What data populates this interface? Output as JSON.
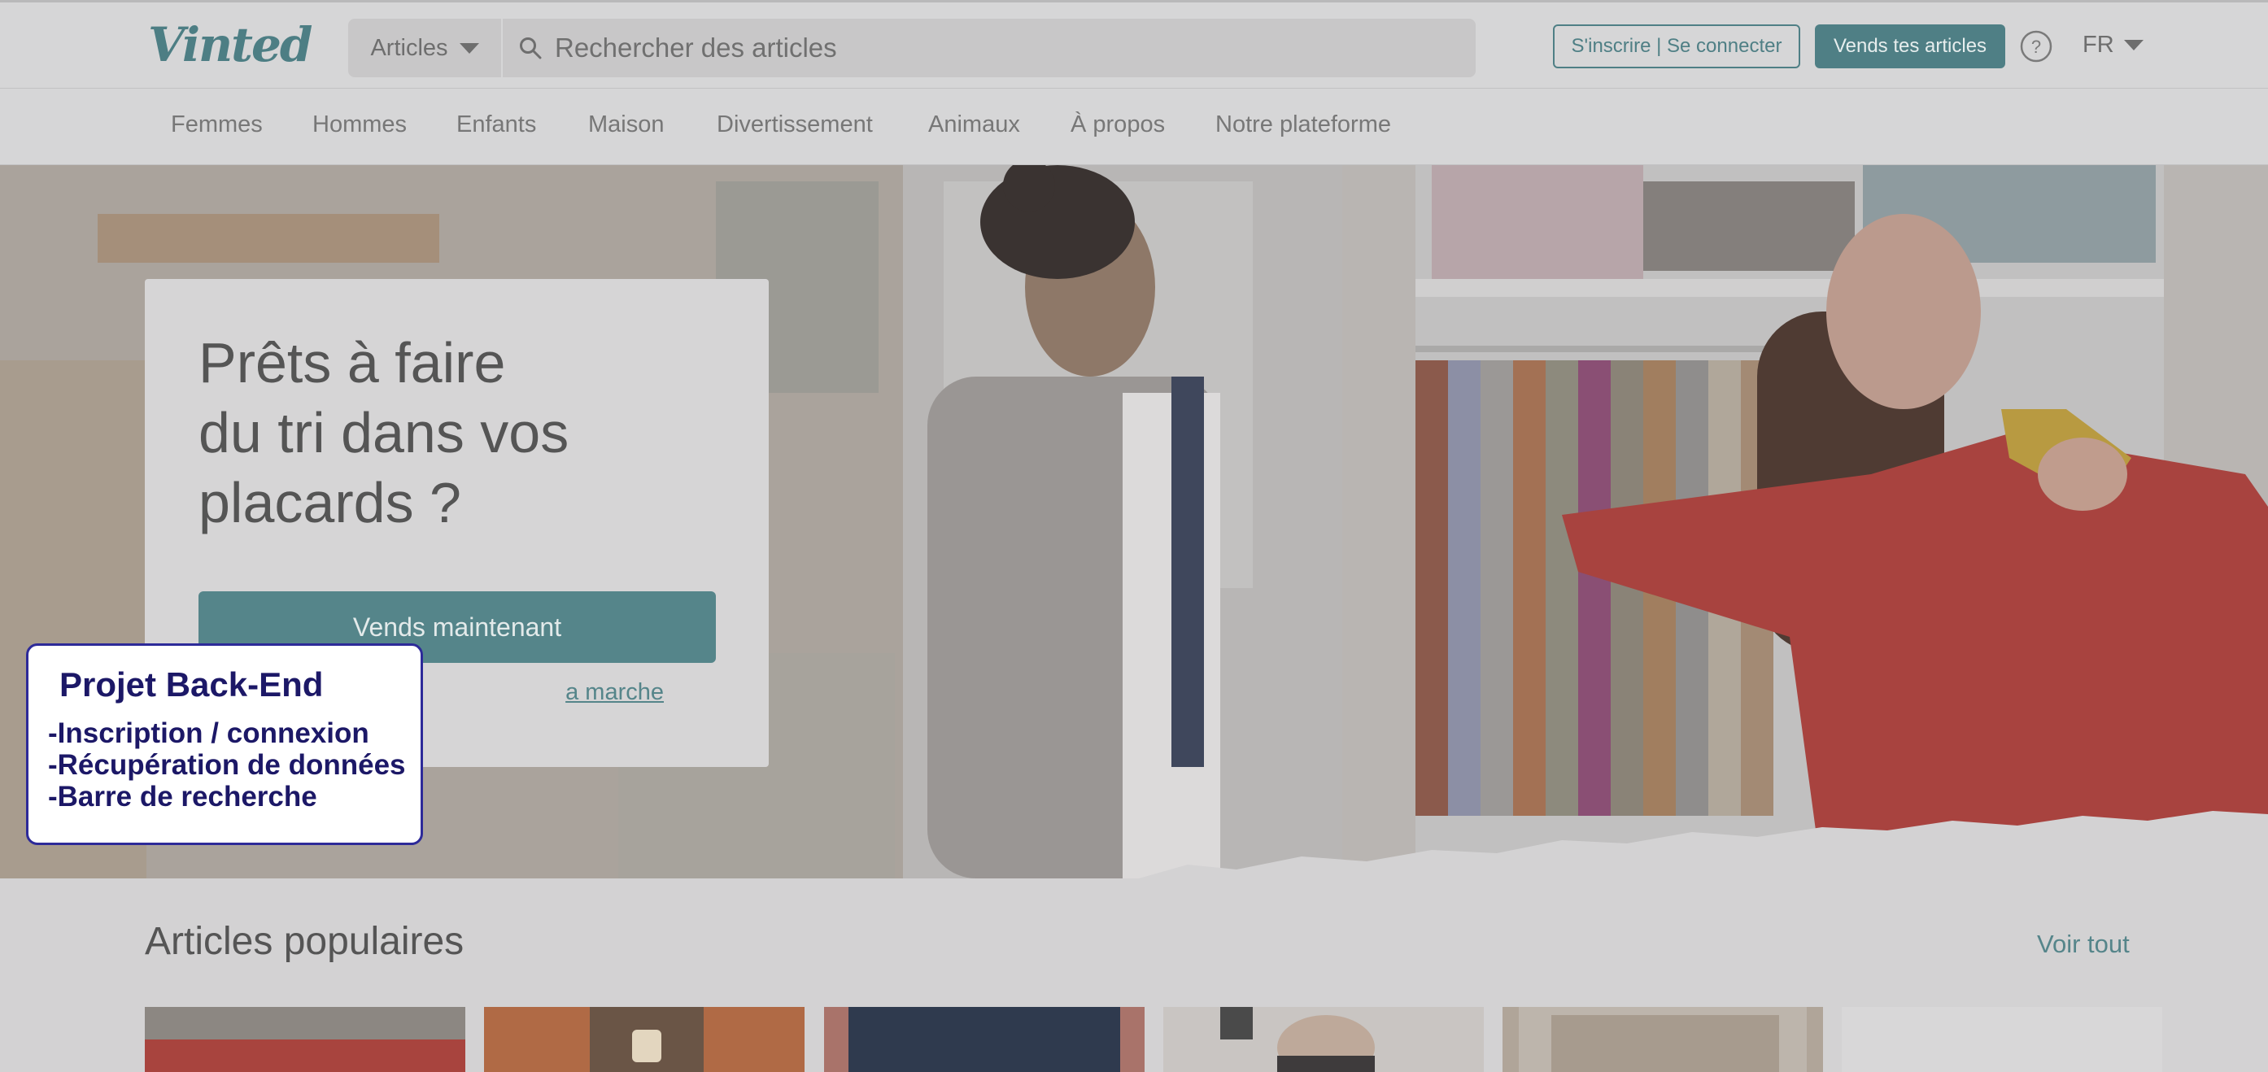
{
  "header": {
    "logo": "Vinted",
    "search": {
      "category": "Articles",
      "placeholder": "Rechercher des articles"
    },
    "login_label": "S'inscrire | Se connecter",
    "sell_label": "Vends tes articles",
    "language": "FR"
  },
  "nav": [
    "Femmes",
    "Hommes",
    "Enfants",
    "Maison",
    "Divertissement",
    "Animaux",
    "À propos",
    "Notre plateforme"
  ],
  "hero": {
    "title_lines": [
      "Prêts à faire",
      "du tri dans vos",
      "placards ?"
    ],
    "cta_label": "Vends maintenant",
    "link_label": "a marche"
  },
  "note": {
    "title": "Projet Back-End",
    "lines": [
      "-Inscription / connexion",
      "-Récupération de données",
      "-Barre de recherche"
    ]
  },
  "popular": {
    "title": "Articles populaires",
    "see_all": "Voir tout"
  },
  "colors": {
    "brand": "#4f7f85",
    "overlay_border": "#2d2a99",
    "overlay_text": "#1c1867"
  },
  "icons": [
    "search-icon",
    "chevron-down-icon",
    "help-icon"
  ]
}
